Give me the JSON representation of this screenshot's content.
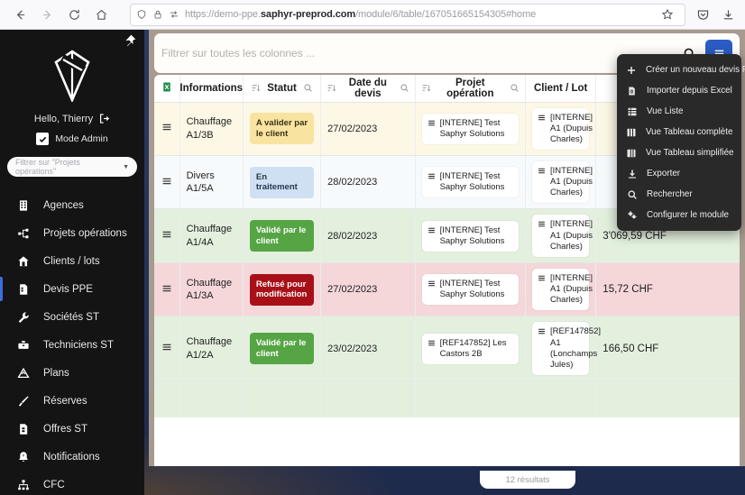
{
  "browser": {
    "nav": {
      "back": "back-arrow",
      "forward": "forward-arrow",
      "reload": "reload",
      "home": "home"
    },
    "url_prefix": "https://demo-ppe.",
    "url_domain": "saphyr-preprod.com",
    "url_suffix": "/module/6/table/167051665154305#home",
    "url_full": "https://demo-ppe.saphyr-preprod.com/module/6/table/167051665154305#home",
    "right_icons": [
      "bookmark-star-icon",
      "pocket-icon",
      "download-icon"
    ]
  },
  "sidebar": {
    "pin_label": "pin-icon",
    "logo": "saphyr-diamond-logo",
    "greeting": "Hello, Thierry",
    "admin_mode_label": "Mode Admin",
    "admin_mode_checked": true,
    "filter_placeholder": "Filtrer sur \"Projets opérations\"",
    "items": [
      {
        "label": "Agences",
        "icon": "building-icon",
        "active": false
      },
      {
        "label": "Projets opérations",
        "icon": "sitemap-icon",
        "active": false
      },
      {
        "label": "Clients / lots",
        "icon": "house-icon",
        "active": false
      },
      {
        "label": "Devis PPE",
        "icon": "document-icon",
        "active": true
      },
      {
        "label": "Sociétés ST",
        "icon": "wrench-icon",
        "active": false
      },
      {
        "label": "Techniciens ST",
        "icon": "toolbox-icon",
        "active": false
      },
      {
        "label": "Plans",
        "icon": "triangle-plan-icon",
        "active": false
      },
      {
        "label": "Réserves",
        "icon": "brush-icon",
        "active": false
      },
      {
        "label": "Offres ST",
        "icon": "file-offer-icon",
        "active": false
      },
      {
        "label": "Notifications",
        "icon": "bell-icon",
        "active": false
      },
      {
        "label": "CFC",
        "icon": "hierarchy-icon",
        "active": false
      }
    ]
  },
  "search": {
    "placeholder": "Filtrer sur toutes les colonnes ...",
    "value": "",
    "search_icon": "search-icon",
    "menu_icon": "hamburger-icon"
  },
  "dropdown": {
    "items": [
      {
        "label": "Créer un nouveau devis PPE",
        "icon": "plus-icon"
      },
      {
        "label": "Importer depuis Excel",
        "icon": "excel-file-icon"
      },
      {
        "label": "Vue Liste",
        "icon": "list-view-icon"
      },
      {
        "label": "Vue Tableau complète",
        "icon": "table-full-icon"
      },
      {
        "label": "Vue Tableau simplifiée",
        "icon": "table-simple-icon"
      },
      {
        "label": "Exporter",
        "icon": "download-icon"
      },
      {
        "label": "Rechercher",
        "icon": "search-icon"
      },
      {
        "label": "Configurer le module",
        "icon": "gear-icon"
      }
    ]
  },
  "table": {
    "headers": [
      {
        "label": "",
        "icon": "excel-icon",
        "sort": false,
        "search": false
      },
      {
        "label": "Informations",
        "sort": false,
        "search": false
      },
      {
        "label": "Statut",
        "sort": true,
        "search": true
      },
      {
        "label": "Date du devis",
        "sort": true,
        "search": true
      },
      {
        "label": "Projet opération",
        "sort": true,
        "search": true
      },
      {
        "label": "Client / Lot",
        "sort": false,
        "search": false
      },
      {
        "label": "",
        "sort": false,
        "search": false
      }
    ],
    "rows": [
      {
        "row_color": "yellow",
        "handle": "drag-handle",
        "information": "Chauffage\nA1/3B",
        "statut": "A valider par le client",
        "statut_style": "yellow",
        "date": "27/02/2023",
        "projet": "[INTERNE] Test Saphyr Solutions",
        "client": "[INTERNE] A1 (Dupuis Charles)",
        "montant": ""
      },
      {
        "row_color": "blue",
        "handle": "drag-handle",
        "information": "Divers\nA1/5A",
        "statut": "En traitement",
        "statut_style": "blue",
        "date": "28/02/2023",
        "projet": "[INTERNE] Test Saphyr Solutions",
        "client": "[INTERNE] A1 (Dupuis Charles)",
        "montant": ""
      },
      {
        "row_color": "green",
        "handle": "drag-handle",
        "information": "Chauffage\nA1/4A",
        "statut": "Validé par le client",
        "statut_style": "green",
        "date": "28/02/2023",
        "projet": "[INTERNE] Test Saphyr Solutions",
        "client": "[INTERNE] A1 (Dupuis Charles)",
        "montant": "3'069,59 CHF"
      },
      {
        "row_color": "red",
        "handle": "drag-handle",
        "information": "Chauffage\nA1/3A",
        "statut": "Refusé pour modification",
        "statut_style": "red",
        "date": "27/02/2023",
        "projet": "[INTERNE] Test Saphyr Solutions",
        "client": "[INTERNE] A1 (Dupuis Charles)",
        "montant": "15,72 CHF"
      },
      {
        "row_color": "green",
        "handle": "drag-handle",
        "information": "Chauffage\nA1/2A",
        "statut": "Validé par le client",
        "statut_style": "green",
        "date": "23/02/2023",
        "projet": "[REF147852] Les Castors 2B",
        "client": "[REF147852] A1 (Lonchamps Jules)",
        "montant": "166,50 CHF"
      }
    ],
    "results_label": "12 résultats"
  },
  "colors": {
    "accent_blue": "#2a5cc4",
    "sidebar_bg": "#141414",
    "active_marker": "#3b6fe0",
    "status_yellow": "#f8e3a0",
    "status_blue": "#cfe0f3",
    "status_green": "#56a544",
    "status_red": "#a81018",
    "row_yellow": "#fdf8e6",
    "row_green": "#e3f0de",
    "row_red": "#f5d7da"
  }
}
